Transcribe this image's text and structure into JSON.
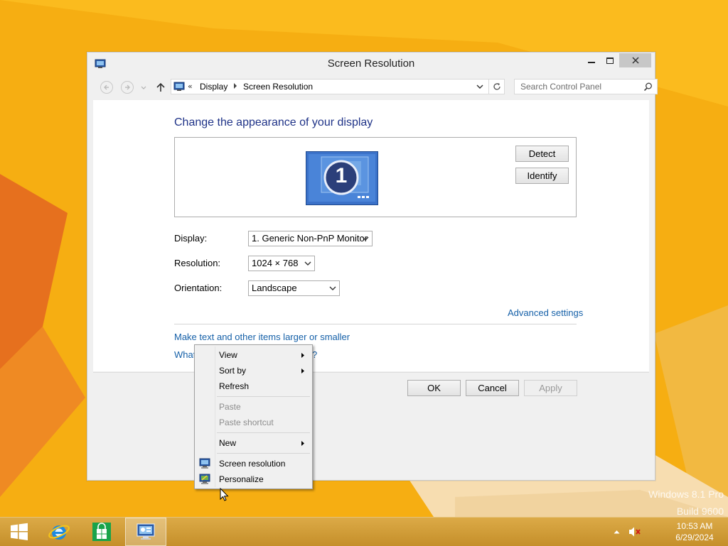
{
  "window": {
    "title": "Screen Resolution",
    "controls": {
      "minimize": "minimize",
      "maximize": "maximize",
      "close": "close"
    }
  },
  "navbar": {
    "breadcrumb_prefix": "«",
    "breadcrumbs": [
      "Display",
      "Screen Resolution"
    ],
    "search_placeholder": "Search Control Panel"
  },
  "content": {
    "heading": "Change the appearance of your display",
    "monitor_number": "1",
    "detect_label": "Detect",
    "identify_label": "Identify",
    "fields": {
      "display_label": "Display:",
      "display_value": "1. Generic Non-PnP Monitor",
      "resolution_label": "Resolution:",
      "resolution_value": "1024 × 768",
      "orientation_label": "Orientation:",
      "orientation_value": "Landscape"
    },
    "advanced_link": "Advanced settings",
    "text_size_link": "Make text and other items larger or smaller",
    "what_link_start": "What",
    "what_link_end": "?"
  },
  "footer": {
    "ok_label": "OK",
    "cancel_label": "Cancel",
    "apply_label": "Apply"
  },
  "context_menu": {
    "items": [
      {
        "label": "View",
        "submenu": true,
        "enabled": true
      },
      {
        "label": "Sort by",
        "submenu": true,
        "enabled": true
      },
      {
        "label": "Refresh",
        "submenu": false,
        "enabled": true
      },
      {
        "label": "Paste",
        "submenu": false,
        "enabled": false
      },
      {
        "label": "Paste shortcut",
        "submenu": false,
        "enabled": false
      },
      {
        "label": "New",
        "submenu": true,
        "enabled": true
      },
      {
        "label": "Screen resolution",
        "submenu": false,
        "enabled": true,
        "icon": "screen-resolution-icon"
      },
      {
        "label": "Personalize",
        "submenu": false,
        "enabled": true,
        "icon": "personalize-icon"
      }
    ]
  },
  "desktop": {
    "watermark_line1": "Windows 8.1 Pro",
    "watermark_line2": "Build 9600"
  },
  "taskbar": {
    "pinned": [
      "start-button",
      "internet-explorer-icon",
      "store-icon",
      "screen-resolution-taskbar-icon"
    ],
    "clock_time": "10:53 AM",
    "clock_date": "6/29/2024"
  },
  "colors": {
    "wallpaper": "#f7b214",
    "heading": "#1e3287",
    "link": "#1560a8",
    "taskbar": "#c9942e"
  }
}
